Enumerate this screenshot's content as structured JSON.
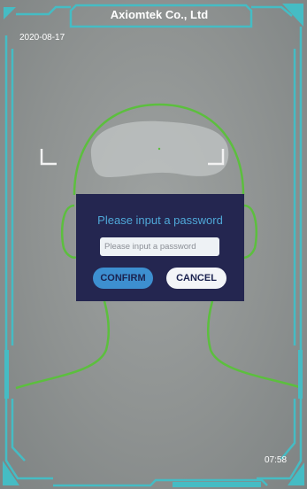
{
  "header": {
    "title": "Axiomtek Co., Ltd"
  },
  "status": {
    "date": "2020-08-17",
    "time": "07:58"
  },
  "dialog": {
    "title": "Please input a password",
    "password_placeholder": "Please input a password",
    "confirm_label": "CONFIRM",
    "cancel_label": "CANCEL"
  },
  "colors": {
    "frame": "#45bcc4",
    "face_guide": "#5cbf3e",
    "dialog_bg": "#242650",
    "accent": "#3d8fd0"
  },
  "icons": [
    "face-guide-outline",
    "corner-bracket-icon"
  ]
}
